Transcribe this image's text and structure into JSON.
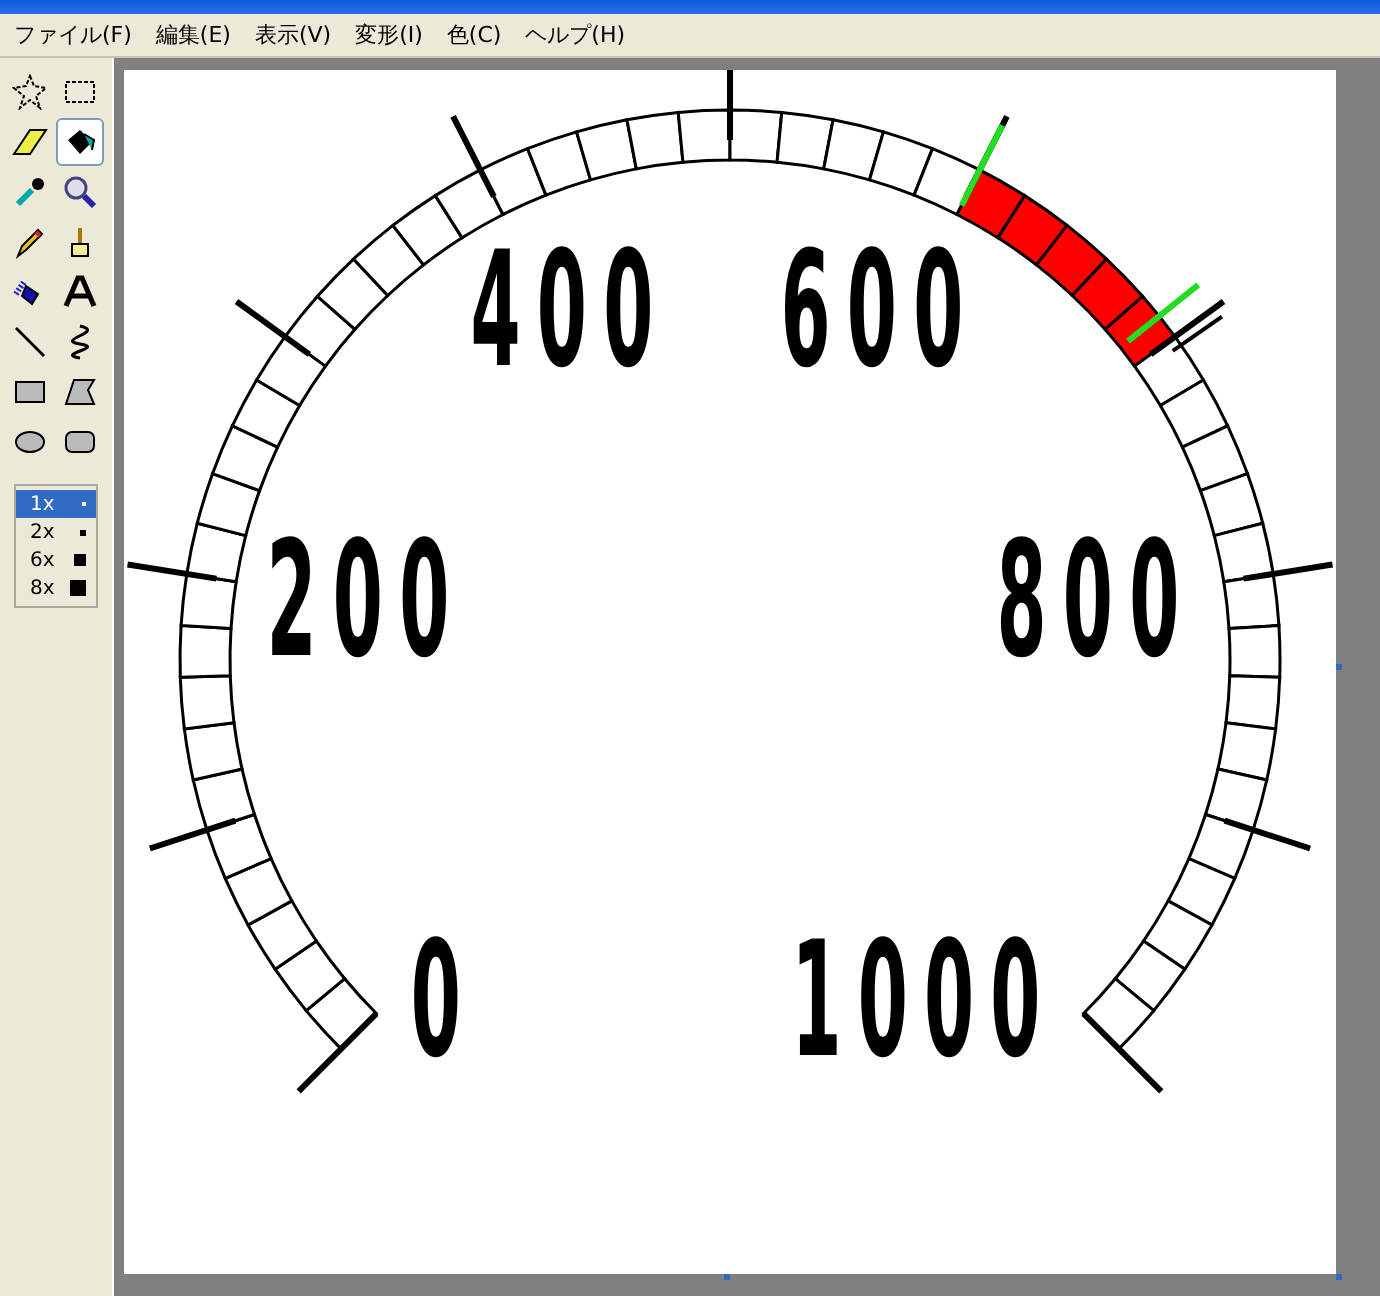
{
  "menu": [
    "ファイル(F)",
    "編集(E)",
    "表示(V)",
    "変形(I)",
    "色(C)",
    "ヘルプ(H)"
  ],
  "tools": [
    {
      "selected": false
    },
    {
      "selected": false
    },
    {
      "selected": false
    },
    {
      "selected": true
    },
    {
      "selected": false
    },
    {
      "selected": false
    },
    {
      "selected": false
    },
    {
      "selected": false
    },
    {
      "selected": false
    },
    {
      "selected": false
    },
    {
      "selected": false
    },
    {
      "selected": false
    },
    {
      "selected": false
    },
    {
      "selected": false
    },
    {
      "selected": false
    },
    {
      "selected": false
    }
  ],
  "zoom_options": [
    {
      "label": "1x",
      "selected": true
    },
    {
      "label": "2x",
      "selected": false
    },
    {
      "label": "6x",
      "selected": false
    },
    {
      "label": "8x",
      "selected": false
    }
  ],
  "canvas": {
    "dial_labels": [
      "400",
      "600",
      "200",
      "800",
      "0",
      "1000"
    ]
  }
}
